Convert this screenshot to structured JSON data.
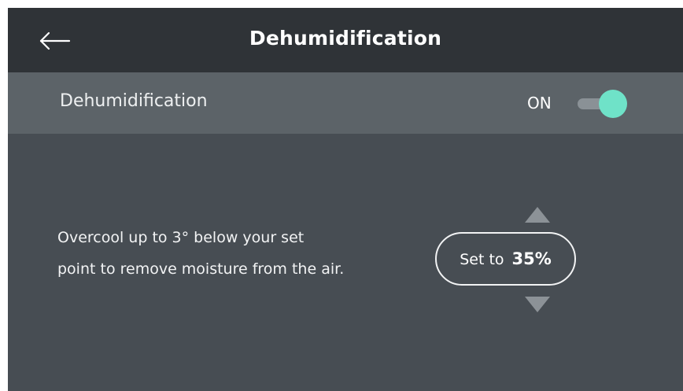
{
  "header": {
    "title": "Dehumidification",
    "back_icon": "arrow-left-icon"
  },
  "setting": {
    "label": "Dehumidification",
    "status": "ON",
    "toggle_on": true,
    "toggle_color": "#6fe2c8"
  },
  "description": {
    "line1": "Overcool up to 3° below your set",
    "line2": "point to remove moisture from the air."
  },
  "setpoint": {
    "prefix": "Set to",
    "value": "35%",
    "increase_icon": "triangle-up-icon",
    "decrease_icon": "triangle-down-icon"
  },
  "colors": {
    "header_bg": "#2f3337",
    "row_bg": "#5c6368",
    "body_bg": "#474d53",
    "accent": "#6fe2c8"
  }
}
